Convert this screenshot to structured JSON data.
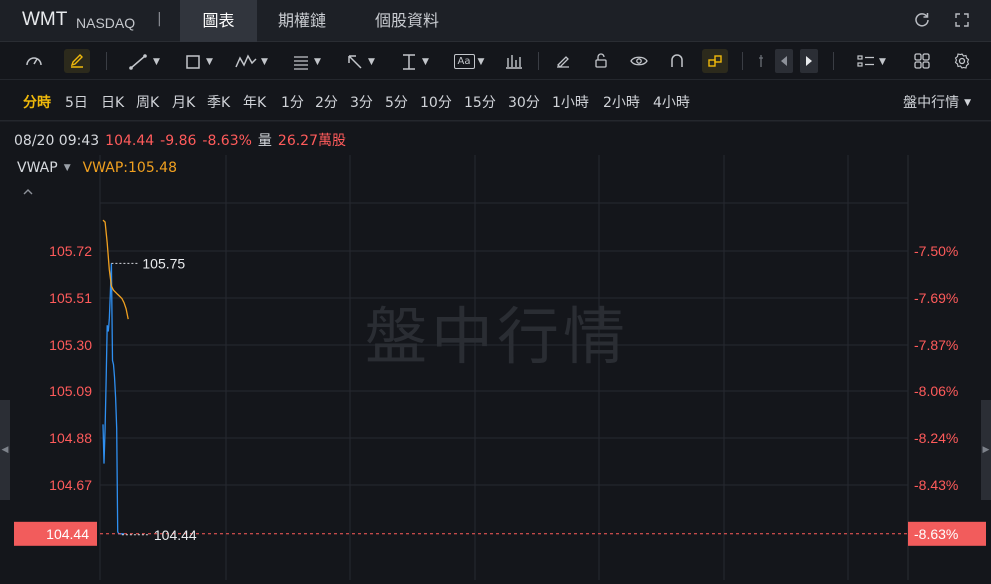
{
  "header": {
    "ticker": "WMT",
    "exchange": "NASDAQ",
    "separator": "|",
    "tabs": [
      {
        "label": "圖表",
        "active": true
      },
      {
        "label": "期權鏈",
        "active": false
      },
      {
        "label": "個股資料",
        "active": false
      }
    ],
    "icons": [
      "refresh-icon",
      "fullscreen-icon"
    ]
  },
  "toolbar": {
    "tools": [
      "gauge-icon",
      "pen-edit-icon",
      "line-draw-icon",
      "rectangle-icon",
      "pattern-icon",
      "fib-lines-icon",
      "arrow-icon",
      "measure-icon",
      "text-annotation-icon",
      "indicator-bars-icon",
      "eraser-icon",
      "lock-icon",
      "eye-icon",
      "magnet-icon",
      "link-icon",
      "split-icon",
      "prev-icon",
      "next-icon",
      "layout-icon",
      "grid-icon",
      "settings-icon"
    ],
    "text_tool_label": "Aa",
    "highlight_color": "#f0b90b"
  },
  "periods": [
    "分時",
    "5日",
    "日K",
    "周K",
    "月K",
    "季K",
    "年K",
    "1分",
    "2分",
    "3分",
    "5分",
    "10分",
    "15分",
    "30分",
    "1小時",
    "2小時",
    "4小時"
  ],
  "active_period": "分時",
  "session_select": "盤中行情",
  "info": {
    "datetime": "08/20 09:43",
    "price": "104.44",
    "change": "-9.86",
    "change_pct": "-8.63%",
    "volume_label": "量",
    "volume": "26.27萬股"
  },
  "indicator": {
    "name": "VWAP",
    "value_text": "VWAP:105.48"
  },
  "colors": {
    "background": "#14161b",
    "price_line": "#2f8ff0",
    "vwap_line": "#f0a020",
    "down_red": "#ff5b5b",
    "grid": "#262930"
  },
  "chart_data": {
    "type": "line",
    "watermark": "盤中行情",
    "y_left_ticks": [
      "105.72",
      "105.51",
      "105.30",
      "105.09",
      "104.88",
      "104.67"
    ],
    "y_right_ticks": [
      "-7.50%",
      "-7.69%",
      "-7.87%",
      "-8.06%",
      "-8.24%",
      "-8.43%"
    ],
    "ylim": [
      104.41,
      105.97
    ],
    "current_price": 104.44,
    "current_price_label": "104.44",
    "current_pct_label": "-8.63%",
    "high_label": "105.75",
    "high_value": 105.75,
    "series": [
      {
        "name": "price",
        "x": [
          0,
          0.25,
          0.5,
          0.75,
          1,
          1.25,
          1.5,
          1.75,
          2,
          2.25,
          2.5,
          2.75,
          3,
          3.25,
          3.5,
          3.75,
          4,
          4.25,
          4.5,
          4.75,
          5
        ],
        "values": [
          104.97,
          104.78,
          104.95,
          105.2,
          105.45,
          105.42,
          105.48,
          105.6,
          105.75,
          105.28,
          105.26,
          105.2,
          105.1,
          104.95,
          104.45,
          104.44,
          104.44,
          104.44,
          104.44,
          104.44,
          104.44
        ]
      },
      {
        "name": "VWAP",
        "x": [
          0,
          0.5,
          1,
          1.5,
          2,
          2.5,
          3,
          3.5,
          4,
          4.5,
          5,
          5.5,
          6
        ],
        "values": [
          105.96,
          105.95,
          105.85,
          105.72,
          105.64,
          105.62,
          105.61,
          105.6,
          105.59,
          105.58,
          105.56,
          105.53,
          105.48
        ]
      }
    ]
  }
}
